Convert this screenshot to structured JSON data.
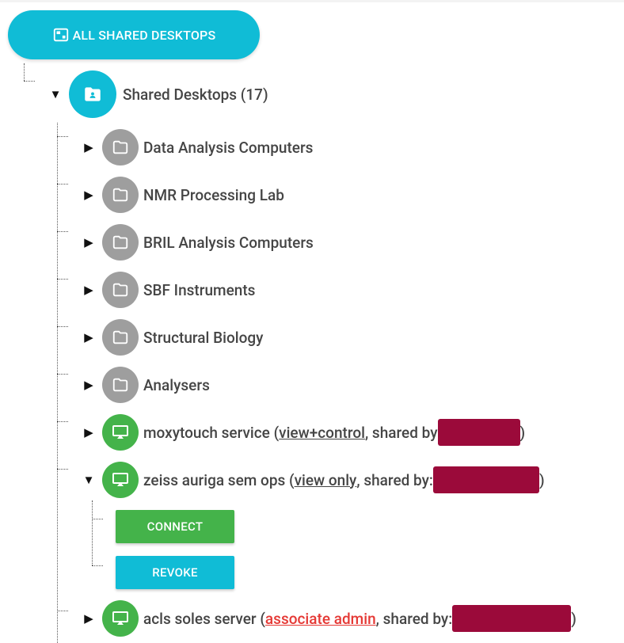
{
  "toolbar": {
    "all_shared_label": "ALL SHARED DESKTOPS"
  },
  "root": {
    "expander": "▼",
    "label": "Shared Desktops (17)"
  },
  "folders": [
    {
      "label": "Data Analysis Computers",
      "expander": "▶"
    },
    {
      "label": "NMR Processing Lab",
      "expander": "▶"
    },
    {
      "label": "BRIL Analysis Computers",
      "expander": "▶"
    },
    {
      "label": "SBF Instruments",
      "expander": "▶"
    },
    {
      "label": "Structural Biology",
      "expander": "▶"
    },
    {
      "label": "Analysers",
      "expander": "▶"
    }
  ],
  "desktops": [
    {
      "expander": "▶",
      "name": "moxytouch service (",
      "permission": "view+control",
      "shared_by": ", shared by",
      "close": ")"
    },
    {
      "expander": "▼",
      "name": "zeiss auriga sem ops (",
      "permission": "view only",
      "shared_by": ", shared by:",
      "close": ")"
    },
    {
      "expander": "▶",
      "name": "acls soles server (",
      "permission": "associate admin",
      "shared_by": ", shared by:",
      "close": ")"
    }
  ],
  "actions": {
    "connect_label": "CONNECT",
    "revoke_label": "REVOKE"
  },
  "colors": {
    "accent": "#10bcd6",
    "success": "#44b34a",
    "folder": "#9e9e9e",
    "redaction": "#9b0a3a",
    "admin": "#e53935"
  }
}
